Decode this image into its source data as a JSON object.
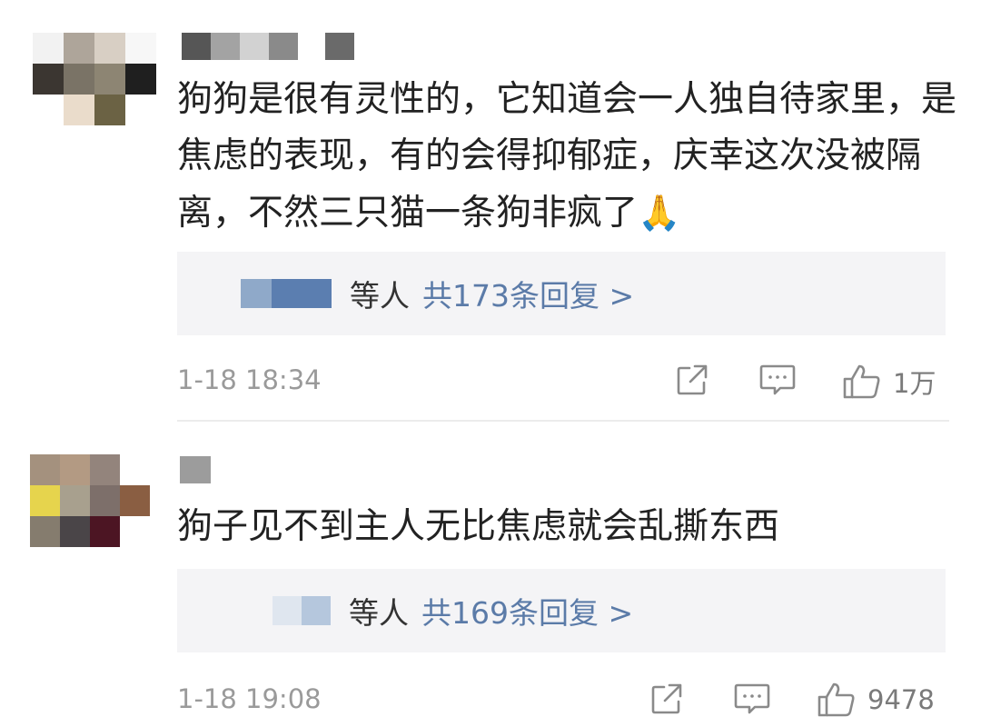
{
  "comments": [
    {
      "text": "狗狗是很有灵性的，它知道会一人独自待家里，是焦虑的表现，有的会得抑郁症，庆幸这次没被隔离，不然三只猫一条狗非疯了",
      "emoji": "🙏",
      "reply_user_suffix": "等人",
      "reply_count_text": "共173条回复 >",
      "timestamp": "1-18 18:34",
      "likes": "1万",
      "icons": [
        "share-icon",
        "comment-icon",
        "like-icon"
      ],
      "accent_color": "#5b7ba8"
    },
    {
      "text": "狗子见不到主人无比焦虑就会乱撕东西",
      "emoji": "",
      "reply_user_suffix": "等人",
      "reply_count_text": "共169条回复 >",
      "timestamp": "1-18 19:08",
      "likes": "9478",
      "icons": [
        "share-icon",
        "comment-icon",
        "like-icon"
      ],
      "accent_color": "#5b7ba8"
    }
  ]
}
